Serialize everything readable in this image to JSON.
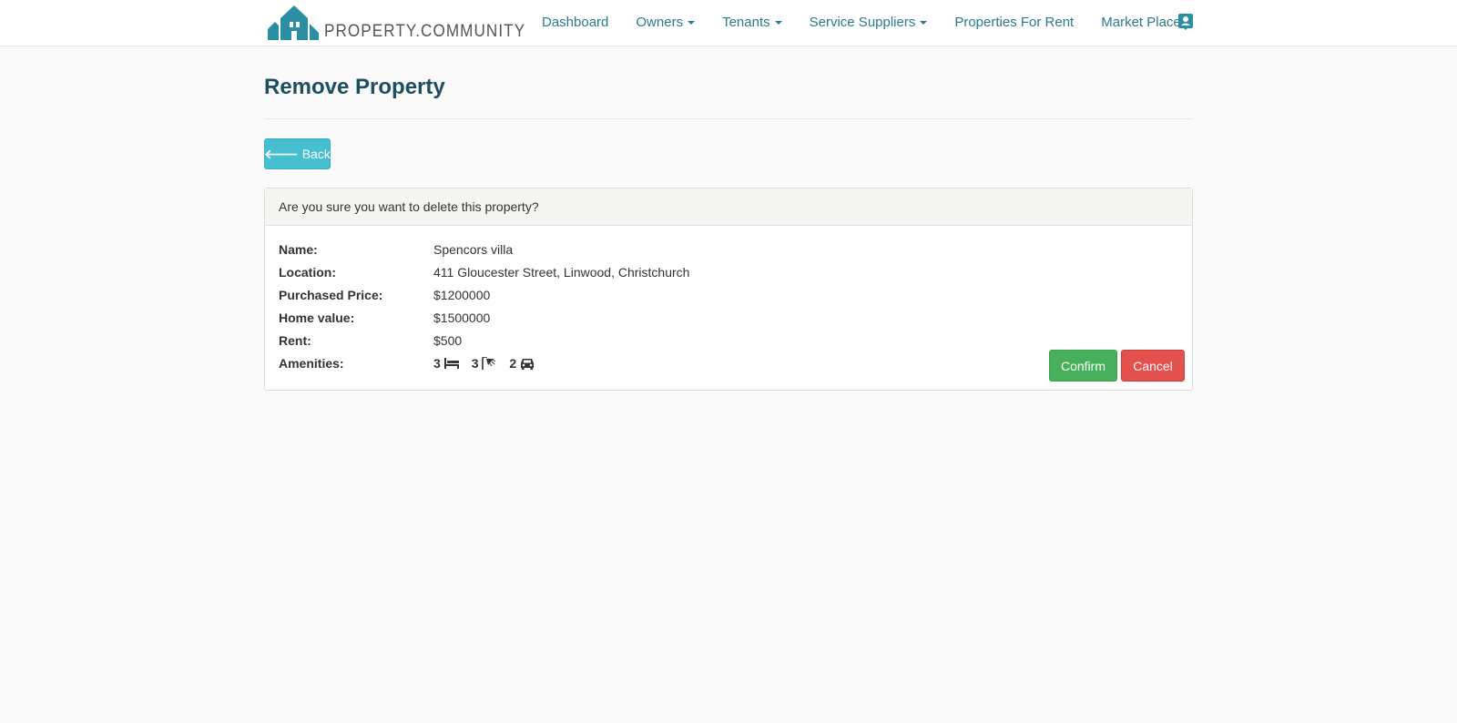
{
  "brand": {
    "name": "PROPERTY.COMMUNITY"
  },
  "nav": {
    "items": [
      {
        "label": "Dashboard",
        "dropdown": false
      },
      {
        "label": "Owners",
        "dropdown": true
      },
      {
        "label": "Tenants",
        "dropdown": true
      },
      {
        "label": "Service Suppliers",
        "dropdown": true
      },
      {
        "label": "Properties For Rent",
        "dropdown": false
      },
      {
        "label": "Market Place",
        "dropdown": false
      }
    ],
    "profile_icon": "contact-card-icon"
  },
  "page": {
    "title": "Remove Property",
    "back_label": "Back",
    "back_icon": "arrow-left-icon"
  },
  "panel": {
    "heading": "Are you sure you want to delete this property?",
    "details": [
      {
        "label": "Name:",
        "value": "Spencors villa"
      },
      {
        "label": "Location:",
        "value": "411 Gloucester Street, Linwood, Christchurch"
      },
      {
        "label": "Purchased Price:",
        "value": "$1200000"
      },
      {
        "label": "Home value:",
        "value": "$1500000"
      },
      {
        "label": "Rent:",
        "value": "$500"
      }
    ],
    "amenities": {
      "label": "Amenities:",
      "bedrooms": "3",
      "bathrooms": "3",
      "parking": "2",
      "icons": [
        "bed-icon",
        "shower-icon",
        "car-icon"
      ]
    },
    "confirm_label": "Confirm",
    "cancel_label": "Cancel"
  },
  "colors": {
    "brand_teal": "#2a8fa3",
    "nav_link": "#2a7a8c",
    "title": "#1e4f5f",
    "back_button": "#47bfd2",
    "confirm_button": "#47b05a",
    "cancel_button": "#e3504d"
  }
}
